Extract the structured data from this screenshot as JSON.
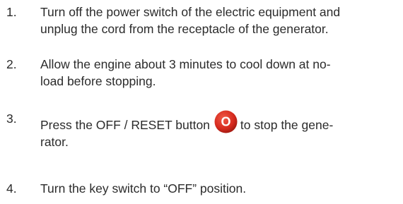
{
  "steps": [
    {
      "number": "1.",
      "lines": [
        "Turn off the power switch of the electric equipment and",
        "unplug the cord from the receptacle of the generator."
      ]
    },
    {
      "number": "2.",
      "lines": [
        "Allow the engine about 3 minutes to cool down at no-",
        "load before stopping."
      ]
    },
    {
      "number": "3.",
      "before_icon": "Press the OFF / RESET button",
      "icon": "off-reset-button-icon",
      "icon_glyph": "O",
      "icon_color": "#d62a1e",
      "after_icon": "to stop the gene-",
      "second_line": "rator."
    },
    {
      "number": "4.",
      "lines": [
        "Turn the key switch  to “OFF” position."
      ]
    }
  ]
}
